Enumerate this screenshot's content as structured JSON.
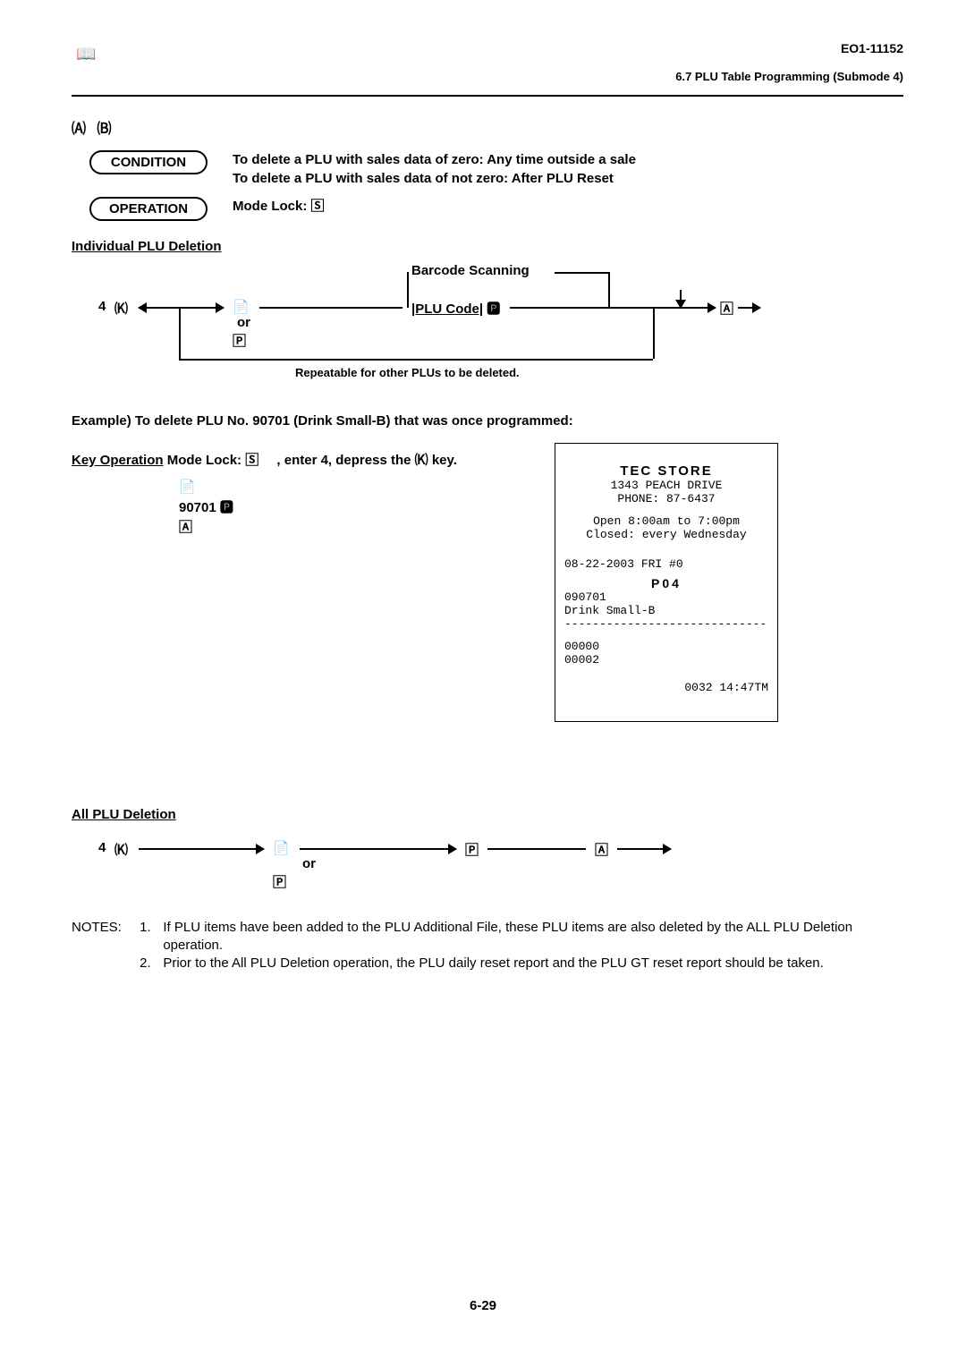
{
  "header": {
    "icon_glyph": "📖",
    "doc_code": "EO1-11152",
    "section_ref": "6.7 PLU Table Programming (Submode 4)"
  },
  "section_number_glyphs": "🄐  🄑",
  "condition": {
    "label": "CONDITION",
    "line1": "To delete a PLU with sales data of zero: Any time outside a sale",
    "line2": "To delete a PLU with sales data of not zero: After PLU Reset"
  },
  "operation": {
    "label": "OPERATION",
    "text": "Mode Lock:",
    "mode_glyph": "🅂"
  },
  "individual_heading": "Individual PLU Deletion",
  "diagram1": {
    "four": "4",
    "k_glyph": "🄚",
    "item1_glyph": "📄",
    "or": "or",
    "item2_glyph": "🄿",
    "barcode_lbl": "Barcode Scanning",
    "plu_code": "|PLU Code|",
    "plu_glyph": "🅿",
    "end_glyph": "🄰",
    "repeat_note": "Repeatable for other PLUs to be deleted."
  },
  "example_line": "Example) To delete PLU No. 90701 (Drink Small-B) that was once programmed:",
  "keyop": {
    "prefix": "Key Operation",
    "text": " Mode Lock:",
    "mode_glyph": "🅂",
    "mid": " , enter 4, depress the",
    "key_glyph": "🄚",
    "suffix": " key.",
    "lines": [
      "📄",
      "90701 🅿",
      "🄰"
    ]
  },
  "receipt": {
    "store": "TEC STORE",
    "addr": "1343 PEACH DRIVE",
    "phone": "PHONE: 87-6437",
    "open": "Open  8:00am to 7:00pm",
    "closed": "Closed: every Wednesday",
    "date": "08-22-2003 FRI  #0",
    "p04": "P04",
    "code": "090701",
    "name": "Drink Small-B",
    "dashes": "-------------------------------",
    "zero1": "00000",
    "zero2": "00002",
    "tm": "0032 14:47TM"
  },
  "all_heading": "All PLU Deletion",
  "diagram2": {
    "four": "4",
    "k_glyph": "🄚",
    "item1_glyph": "📄",
    "or": "or",
    "item2_glyph": "🄿",
    "mid_glyph": "🄿",
    "end_glyph": "🄰"
  },
  "notes": {
    "label": "NOTES:",
    "n1": "If PLU items have been added to the PLU Additional File, these PLU items are also deleted by the ALL PLU Deletion operation.",
    "n2": "Prior to the All PLU Deletion operation, the PLU daily reset report and the PLU GT reset report should be taken."
  },
  "page_no": "6-29"
}
